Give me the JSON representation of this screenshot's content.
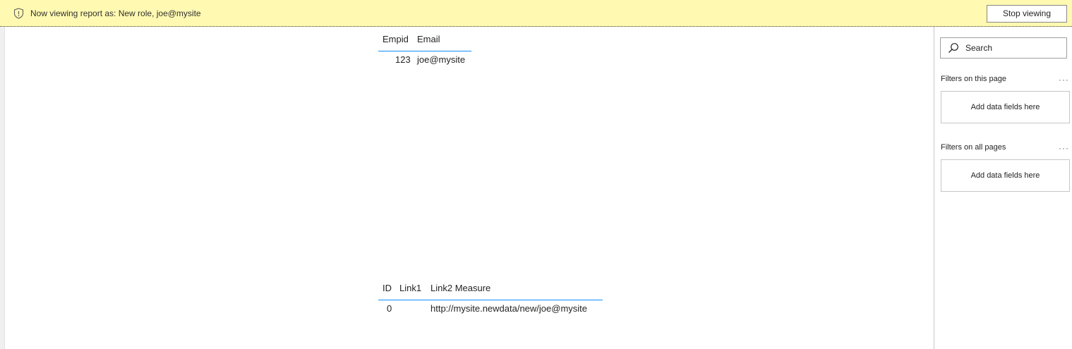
{
  "banner": {
    "message": "Now viewing report as: New role, joe@mysite",
    "stop_button": "Stop viewing"
  },
  "table1": {
    "headers": [
      "Empid",
      "Email"
    ],
    "rows": [
      [
        "123",
        "joe@mysite"
      ]
    ]
  },
  "table2": {
    "headers": [
      "ID",
      "Link1",
      "Link2 Measure"
    ],
    "rows": [
      [
        "0",
        "",
        "http://mysite.newdata/new/joe@mysite"
      ]
    ]
  },
  "filters": {
    "search_placeholder": "Search",
    "page_section": "Filters on this page",
    "all_section": "Filters on all pages",
    "more_glyph": "···",
    "drop_zone_label": "Add data fields here"
  },
  "colors": {
    "banner_bg": "#fff9b1",
    "accent_rule": "#118dff"
  }
}
